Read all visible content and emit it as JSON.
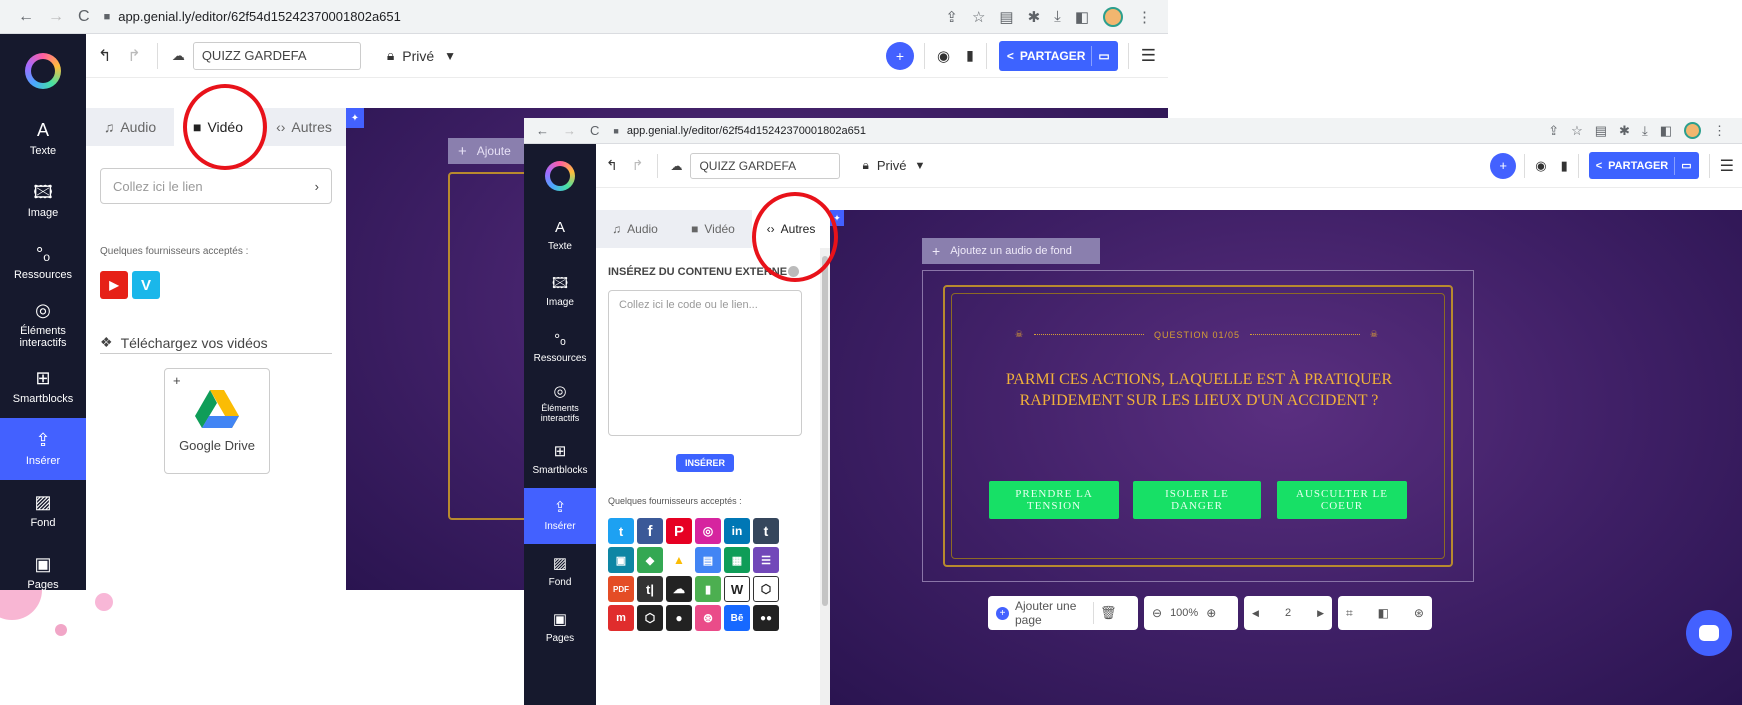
{
  "background_window": {
    "browser": {
      "url": "app.genial.ly/editor/62f54d15242370001802a651"
    },
    "topbar": {
      "project_name": "QUIZZ GARDEFA",
      "privacy": "Privé",
      "share_label": "PARTAGER"
    },
    "sidebar": {
      "items": [
        {
          "label": "Texte",
          "icon": "text-icon"
        },
        {
          "label": "Image",
          "icon": "image-icon"
        },
        {
          "label": "Ressources",
          "icon": "resources-icon"
        },
        {
          "label": "Éléments interactifs",
          "icon": "interactive-icon"
        },
        {
          "label": "Smartblocks",
          "icon": "smartblocks-icon"
        },
        {
          "label": "Insérer",
          "icon": "insert-icon"
        },
        {
          "label": "Fond",
          "icon": "background-icon"
        },
        {
          "label": "Pages",
          "icon": "pages-icon"
        }
      ]
    },
    "panel": {
      "tabs": [
        {
          "label": "Audio",
          "icon": "music-icon"
        },
        {
          "label": "Vidéo",
          "icon": "video-icon"
        },
        {
          "label": "Autres",
          "icon": "code-icon"
        }
      ],
      "link_placeholder": "Collez ici le lien",
      "providers_label": "Quelques fournisseurs acceptés :",
      "upload_label": "Téléchargez vos vidéos",
      "drive_label": "Google Drive"
    },
    "canvas": {
      "add_audio_label": "Ajoute"
    }
  },
  "front_window": {
    "browser": {
      "url": "app.genial.ly/editor/62f54d15242370001802a651"
    },
    "topbar": {
      "project_name": "QUIZZ GARDEFA",
      "privacy": "Privé",
      "share_label": "PARTAGER"
    },
    "sidebar": {
      "items": [
        {
          "label": "Texte",
          "icon": "text-icon"
        },
        {
          "label": "Image",
          "icon": "image-icon"
        },
        {
          "label": "Ressources",
          "icon": "resources-icon"
        },
        {
          "label": "Éléments interactifs",
          "icon": "interactive-icon"
        },
        {
          "label": "Smartblocks",
          "icon": "smartblocks-icon"
        },
        {
          "label": "Insérer",
          "icon": "insert-icon"
        },
        {
          "label": "Fond",
          "icon": "background-icon"
        },
        {
          "label": "Pages",
          "icon": "pages-icon"
        }
      ]
    },
    "panel": {
      "tabs": [
        {
          "label": "Audio",
          "icon": "music-icon"
        },
        {
          "label": "Vidéo",
          "icon": "video-icon"
        },
        {
          "label": "Autres",
          "icon": "code-icon"
        }
      ],
      "section_title": "INSÉREZ DU CONTENU EXTERNE",
      "code_placeholder": "Collez ici le code ou le lien...",
      "insert_button": "INSÉRER",
      "providers_label": "Quelques fournisseurs acceptés :"
    },
    "canvas": {
      "add_audio_label": "Ajoutez un audio de fond",
      "question_label": "QUESTION 01/05",
      "question_text": "PARMI CES ACTIONS, LAQUELLE EST À PRATIQUER RAPIDEMENT SUR LES LIEUX D'UN ACCIDENT ?",
      "answers": [
        "PRENDRE LA TENSION",
        "ISOLER LE DANGER",
        "AUSCULTER LE COEUR"
      ]
    },
    "bottom": {
      "add_page": "Ajouter une page",
      "zoom": "100%",
      "page_number": "2"
    }
  },
  "colors": {
    "sidebar": "#16192d",
    "accent": "#4361ff",
    "answer_green": "#17e066",
    "canvas_purple": "#3e1f65",
    "highlight_circle": "#e8121a"
  }
}
